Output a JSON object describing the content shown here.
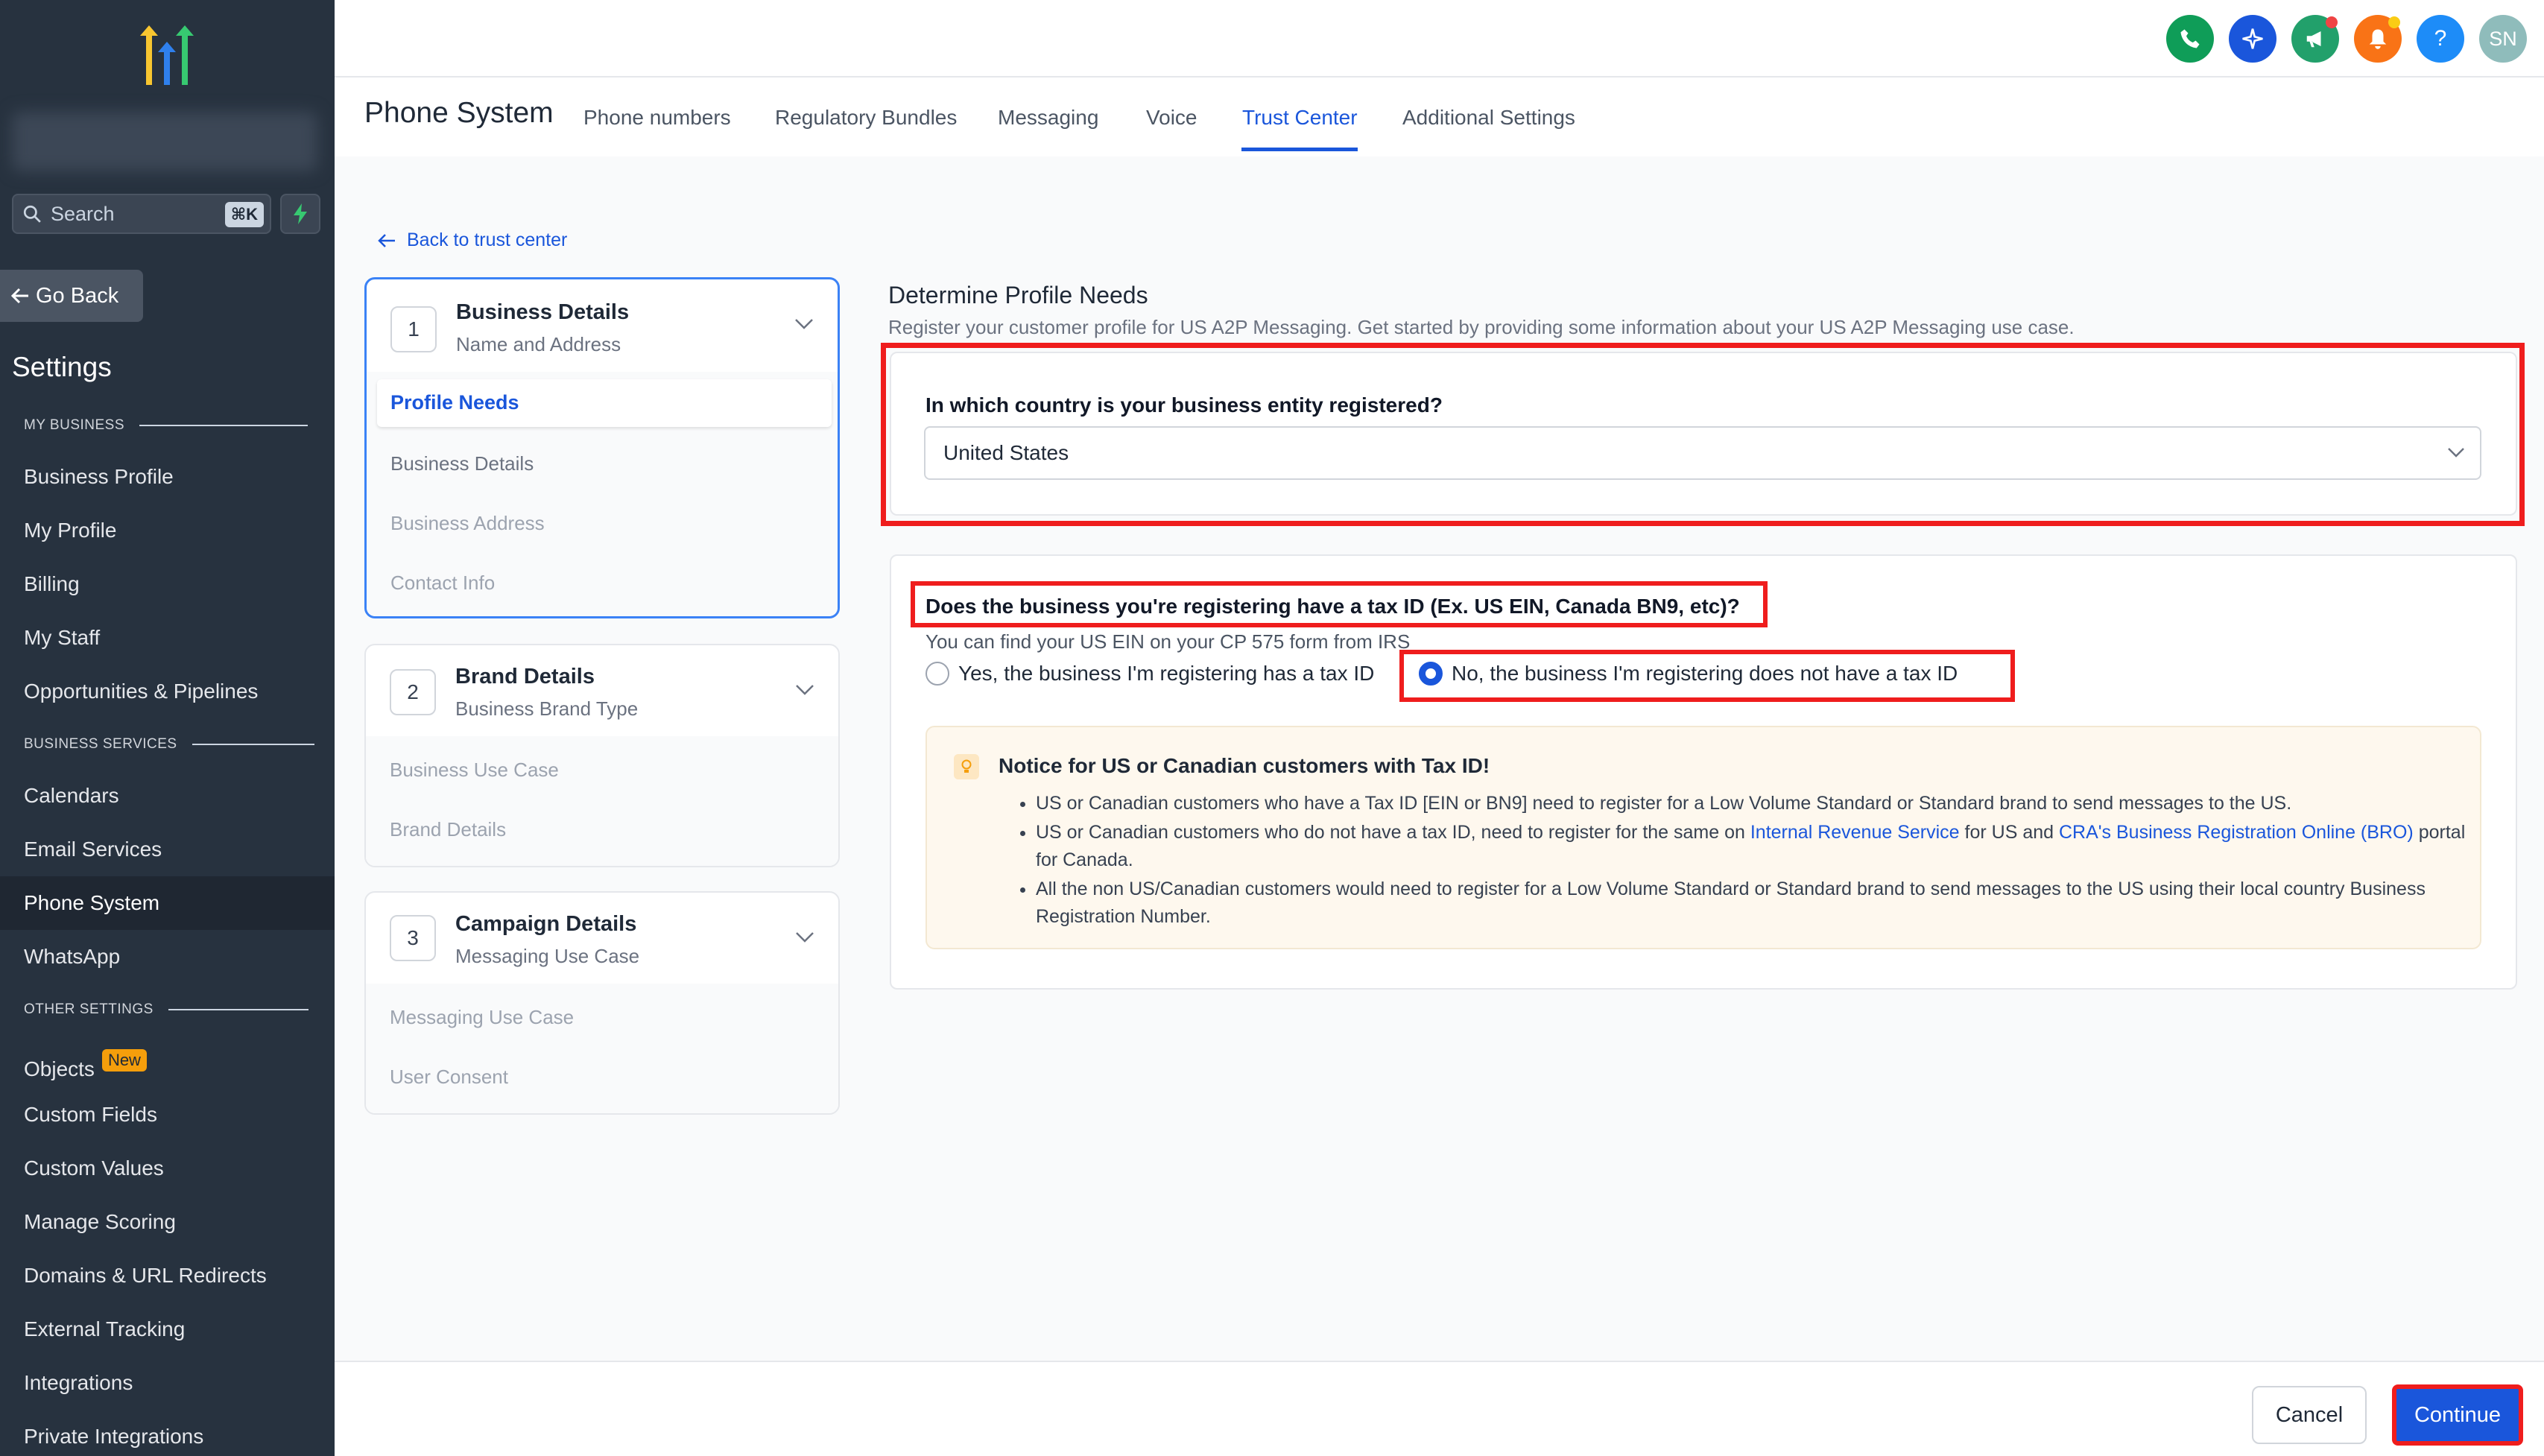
{
  "sidebar": {
    "search_placeholder": "Search",
    "search_shortcut": "⌘K",
    "go_back": "Go Back",
    "settings_title": "Settings",
    "sections": {
      "my_business": "MY BUSINESS",
      "business_services": "BUSINESS SERVICES",
      "other_settings": "OTHER SETTINGS"
    },
    "items": [
      "Business Profile",
      "My Profile",
      "Billing",
      "My Staff",
      "Opportunities & Pipelines",
      "Calendars",
      "Email Services",
      "Phone System",
      "WhatsApp",
      "Objects",
      "Custom Fields",
      "Custom Values",
      "Manage Scoring",
      "Domains & URL Redirects",
      "External Tracking",
      "Integrations",
      "Private Integrations"
    ],
    "active_item": "Phone System",
    "new_badge": "New"
  },
  "topbar": {
    "avatar_initials": "SN",
    "help_glyph": "?",
    "colors": {
      "phone": "#0f9d58",
      "ai": "#1a56db",
      "announce": "#22a06b",
      "bell": "#f97316",
      "help": "#1d8cf8",
      "avatar": "#8fbcbb"
    }
  },
  "header": {
    "title": "Phone System",
    "tabs": [
      "Phone numbers",
      "Regulatory Bundles",
      "Messaging",
      "Voice",
      "Trust Center",
      "Additional Settings"
    ],
    "active_tab": "Trust Center"
  },
  "back_link": "Back to trust center",
  "steps": [
    {
      "number": "1",
      "title": "Business Details",
      "subtitle": "Name and Address",
      "items": [
        "Profile Needs",
        "Business Details",
        "Business Address",
        "Contact Info"
      ],
      "active_item": "Profile Needs"
    },
    {
      "number": "2",
      "title": "Brand Details",
      "subtitle": "Business Brand Type",
      "items": [
        "Business Use Case",
        "Brand Details"
      ]
    },
    {
      "number": "3",
      "title": "Campaign Details",
      "subtitle": "Messaging Use Case",
      "items": [
        "Messaging Use Case",
        "User Consent"
      ]
    }
  ],
  "form": {
    "heading": "Determine Profile Needs",
    "description": "Register your customer profile for US A2P Messaging. Get started by providing some information about your US A2P Messaging use case.",
    "country_question": "In which country is your business entity registered?",
    "country_value": "United States",
    "tax_question": "Does the business you're registering have a tax ID (Ex. US EIN, Canada BN9, etc)?",
    "tax_help": "You can find your US EIN on your CP 575 form from IRS",
    "tax_options": [
      "Yes, the business I'm registering has a tax ID",
      "No, the business I'm registering does not have a tax ID"
    ],
    "tax_selected": "No, the business I'm registering does not have a tax ID"
  },
  "notice": {
    "title": "Notice for US or Canadian customers with Tax ID!",
    "bullet1": "US or Canadian customers who have a Tax ID [EIN or BN9] need to register for a Low Volume Standard or Standard brand to send messages to the US.",
    "bullet2_pre": "US or Canadian customers who do not have a tax ID, need to register for the same on ",
    "bullet2_link1": "Internal Revenue Service",
    "bullet2_mid": " for US and ",
    "bullet2_link2": "CRA's Business Registration Online (BRO)",
    "bullet2_post": " portal for Canada.",
    "bullet3": "All the non US/Canadian customers would need to register for a Low Volume Standard or Standard brand to send messages to the US using their local country Business Registration Number."
  },
  "footer": {
    "cancel": "Cancel",
    "continue": "Continue"
  },
  "highlight_color": "#ef1d1d",
  "accent_color": "#1a56db"
}
